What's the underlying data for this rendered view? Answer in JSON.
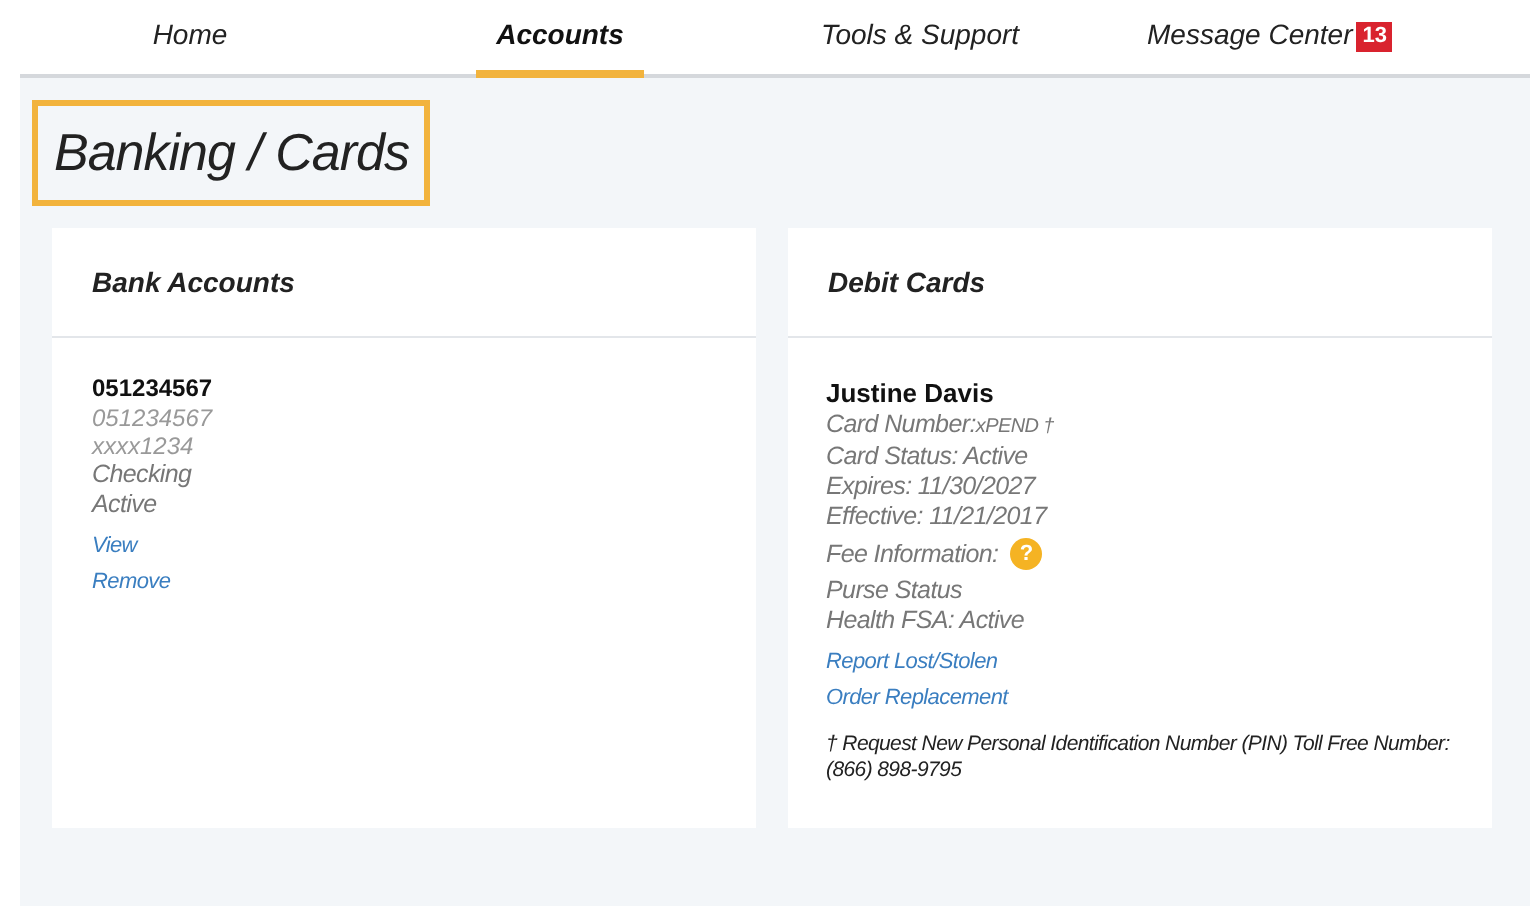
{
  "nav": [
    {
      "label": "Home",
      "selected": false
    },
    {
      "label": "Accounts",
      "selected": true
    },
    {
      "label": "Tools & Support",
      "selected": false
    },
    {
      "label": "Message Center",
      "selected": false,
      "badge": "13"
    }
  ],
  "page_title": "Banking / Cards",
  "bank_accounts": {
    "title": "Bank Accounts",
    "name": "051234567",
    "details": [
      "051234567",
      "xxxx1234"
    ],
    "lines": [
      "Checking",
      "Active"
    ],
    "links": [
      "View",
      "Remove"
    ]
  },
  "debit_cards": {
    "title": "Debit Cards",
    "name": "Justine Davis",
    "card_number_label": "Card Number:",
    "card_number_value": "xPEND †",
    "lines": [
      "Card Status: Active",
      "Expires: 11/30/2027",
      "Effective: 11/21/2017"
    ],
    "fee_label": "Fee Information:",
    "fee_icon": "?",
    "purse_lines": [
      "Purse Status",
      "Health FSA: Active"
    ],
    "links": [
      "Report Lost/Stolen",
      "Order Replacement"
    ],
    "footnote": "† Request New Personal Identification Number (PIN) Toll Free Number: (866) 898-9795"
  }
}
